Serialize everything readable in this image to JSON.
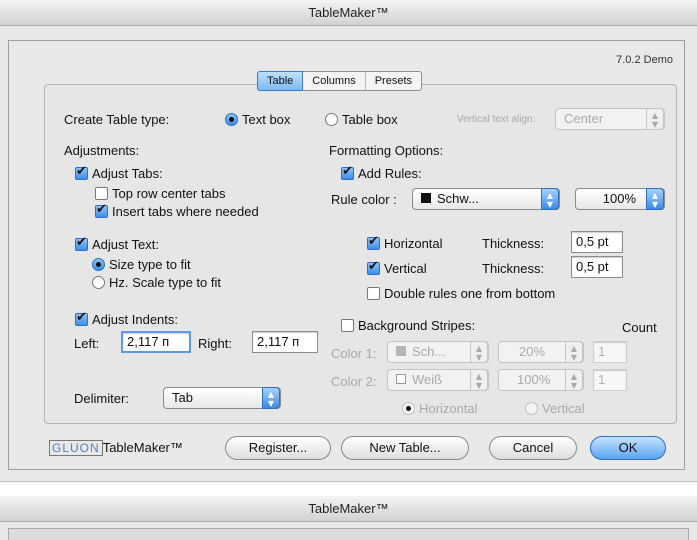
{
  "window": {
    "title": "TableMaker™",
    "version": "7.0.2 Demo"
  },
  "tabs": [
    "Table",
    "Columns",
    "Presets"
  ],
  "create": {
    "label": "Create Table type:",
    "text_box": "Text box",
    "table_box": "Table box",
    "vertical_align_label": "Vertical text align:",
    "vertical_align_value": "Center"
  },
  "adjustments": {
    "title": "Adjustments:",
    "adjust_tabs": "Adjust Tabs:",
    "top_row_center": "Top row center tabs",
    "insert_tabs": "Insert tabs where needed",
    "adjust_text": "Adjust Text:",
    "size_type": "Size type to fit",
    "hz_scale": "Hz. Scale type to fit",
    "adjust_indents": "Adjust Indents:",
    "left_label": "Left:",
    "left_value": "2,117 п",
    "right_label": "Right:",
    "right_value": "2,117 п",
    "delimiter_label": "Delimiter:",
    "delimiter_value": "Tab"
  },
  "formatting": {
    "title": "Formatting Options:",
    "add_rules": "Add Rules:",
    "rule_color_label": "Rule color :",
    "rule_color_value": "Schw...",
    "rule_shade_value": "100%",
    "horizontal": "Horizontal",
    "vertical": "Vertical",
    "thickness_label": "Thickness:",
    "h_thickness": "0,5 pt",
    "v_thickness": "0,5 pt",
    "double_rules": "Double rules one from bottom",
    "bg_stripes": "Background Stripes:",
    "count_label": "Count",
    "color1_label": "Color 1:",
    "color1_value": "Sch...",
    "color1_shade": "20%",
    "color1_count": "1",
    "color2_label": "Color 2:",
    "color2_value": "Weiß",
    "color2_shade": "100%",
    "color2_count": "1",
    "stripe_horizontal": "Horizontal",
    "stripe_vertical": "Vertical"
  },
  "footer": {
    "logo_brand": "GLUON",
    "logo_product": "TableMaker™",
    "register": "Register...",
    "new_table": "New Table...",
    "cancel": "Cancel",
    "ok": "OK"
  },
  "second_window": {
    "title": "TableMaker™"
  }
}
